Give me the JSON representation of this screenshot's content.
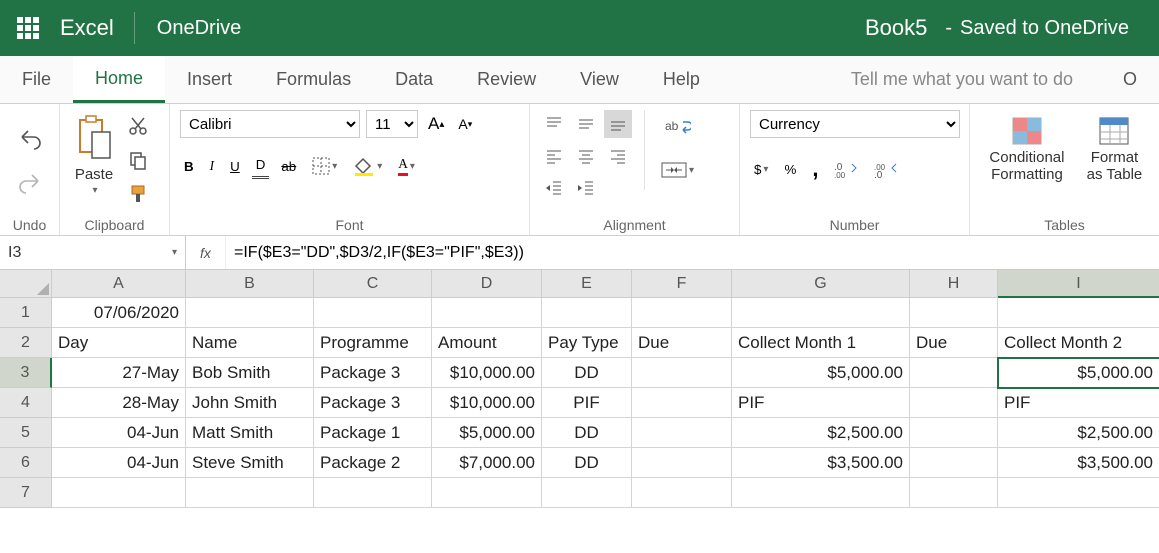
{
  "titlebar": {
    "app_name": "Excel",
    "location": "OneDrive",
    "doc_name": "Book5",
    "separator": "-",
    "saved_status": "Saved to OneDrive"
  },
  "menu": {
    "items": [
      "File",
      "Home",
      "Insert",
      "Formulas",
      "Data",
      "Review",
      "View",
      "Help"
    ],
    "active": "Home",
    "tell_me": "Tell me what you want to do",
    "overflow": "O"
  },
  "ribbon": {
    "undo_label": "Undo",
    "clipboard_label": "Clipboard",
    "paste_label": "Paste",
    "font_label": "Font",
    "font_name": "Calibri",
    "font_size": "11",
    "alignment_label": "Alignment",
    "number_label": "Number",
    "number_format": "Currency",
    "cond_fmt_label": "Conditional Formatting",
    "format_table_label": "Format as Table",
    "tables_label": "Tables"
  },
  "formula_bar": {
    "name_box": "I3",
    "fx": "fx",
    "formula": "=IF($E3=\"DD\",$D3/2,IF($E3=\"PIF\",$E3))"
  },
  "sheet": {
    "columns": [
      "A",
      "B",
      "C",
      "D",
      "E",
      "F",
      "G",
      "H",
      "I"
    ],
    "row_headers": [
      "1",
      "2",
      "3",
      "4",
      "5",
      "6",
      "7"
    ],
    "active_cell": "I3",
    "rows": [
      {
        "A": "07/06/2020",
        "B": "",
        "C": "",
        "D": "",
        "E": "",
        "F": "",
        "G": "",
        "H": "",
        "I": ""
      },
      {
        "A": "Day",
        "B": "Name",
        "C": "Programme",
        "D": "Amount",
        "E": "Pay Type",
        "F": "Due",
        "G": "Collect Month 1",
        "H": "Due",
        "I": "Collect Month 2"
      },
      {
        "A": "27-May",
        "B": "Bob Smith",
        "C": "Package 3",
        "D": "$10,000.00",
        "E": "DD",
        "F": "",
        "G": "$5,000.00",
        "H": "",
        "I": "$5,000.00"
      },
      {
        "A": "28-May",
        "B": "John Smith",
        "C": "Package 3",
        "D": "$10,000.00",
        "E": "PIF",
        "F": "",
        "G": "PIF",
        "H": "",
        "I": "PIF"
      },
      {
        "A": "04-Jun",
        "B": "Matt Smith",
        "C": "Package 1",
        "D": "$5,000.00",
        "E": "DD",
        "F": "",
        "G": "$2,500.00",
        "H": "",
        "I": "$2,500.00"
      },
      {
        "A": "04-Jun",
        "B": "Steve Smith",
        "C": "Package 2",
        "D": "$7,000.00",
        "E": "DD",
        "F": "",
        "G": "$3,500.00",
        "H": "",
        "I": "$3,500.00"
      },
      {
        "A": "",
        "B": "",
        "C": "",
        "D": "",
        "E": "",
        "F": "",
        "G": "",
        "H": "",
        "I": ""
      }
    ]
  }
}
